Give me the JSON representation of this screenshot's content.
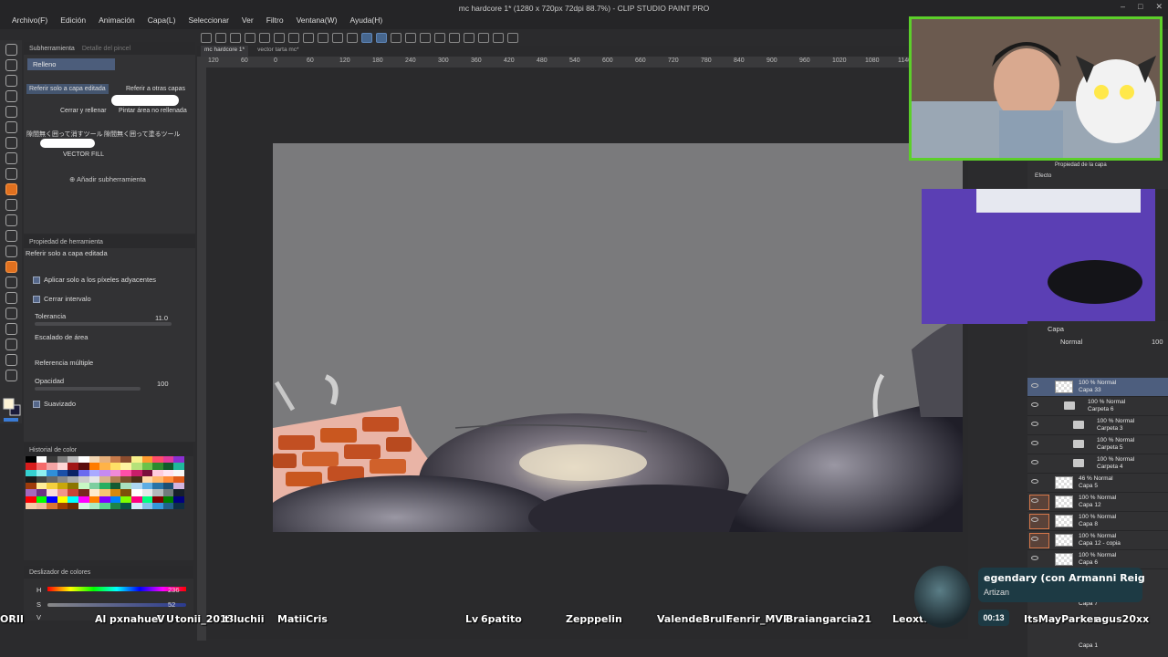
{
  "window": {
    "title": "mc hardcore 1* (1280 x 720px 72dpi 88.7%) - CLIP STUDIO PAINT PRO",
    "controls": [
      "–",
      "□",
      "✕"
    ]
  },
  "menu": [
    "Archivo(F)",
    "Edición",
    "Animación",
    "Capa(L)",
    "Seleccionar",
    "Ver",
    "Filtro",
    "Ventana(W)",
    "Ayuda(H)"
  ],
  "doc_tabs": [
    "mc hardcore 1*",
    "vector tarta mc*"
  ],
  "ruler_ticks": [
    "120",
    "60",
    "0",
    "60",
    "120",
    "180",
    "240",
    "300",
    "360",
    "420",
    "480",
    "540",
    "600",
    "660",
    "720",
    "780",
    "840",
    "900",
    "960",
    "1020",
    "1080",
    "1140"
  ],
  "subtool": {
    "tab": "Subherramienta",
    "tab2": "Detalle del pincel",
    "group": "Relleno",
    "items": [
      "Referir solo a capa editada",
      "Referir a otras capas",
      "Cerrar y rellenar",
      "Pintar área no rellenada",
      "隙間無く囲って消すツール",
      "隙間無く囲って塗るツール",
      "VECTOR FILL"
    ],
    "add": "Añadir subherramienta"
  },
  "tool_property": {
    "tab": "Propiedad de herramienta",
    "name": "Referir solo a capa editada",
    "adjacent": "Aplicar solo a los píxeles adyacentes",
    "close_gap": "Cerrar intervalo",
    "tolerance_label": "Tolerancia",
    "tolerance_value": "11.0",
    "scale_label": "Escalado de área",
    "multi_ref": "Referencia múltiple",
    "opacity_label": "Opacidad",
    "opacity_value": "100",
    "smooth": "Suavizado"
  },
  "color_panel": {
    "tab": "Historial de color",
    "slider_tab": "Deslizador de colores",
    "h_label": "H",
    "h_value": "236",
    "s_label": "S",
    "s_value": "52",
    "v_label": "V",
    "swatches": [
      "#000000",
      "#ffffff",
      "#3a3a3a",
      "#7a7a7a",
      "#bbbbbb",
      "#ffffff",
      "#f2d6b3",
      "#e7b07b",
      "#c87b4b",
      "#8b4c2e",
      "#f7f08a",
      "#ff9a2f",
      "#ff4d6a",
      "#e13a9a",
      "#8b2fd1",
      "#d81c1c",
      "#f56a6a",
      "#f4a4a4",
      "#ffd6d6",
      "#a01616",
      "#5a0c0c",
      "#ff7b00",
      "#ffb347",
      "#ffe066",
      "#fff3a0",
      "#b5e27a",
      "#6cc24a",
      "#2d8a2d",
      "#0e5a2a",
      "#1fb89c",
      "#35d1d1",
      "#8ff0f0",
      "#2f8fd9",
      "#1a4fa8",
      "#0b2266",
      "#6a6af0",
      "#a9a9ff",
      "#c58af2",
      "#f08ad8",
      "#ff4fa8",
      "#c91e6a",
      "#7a0f3c",
      "#ffccdd",
      "#ffe4f0",
      "#f7f7f7",
      "#1b1b1b",
      "#444444",
      "#666666",
      "#888888",
      "#aaaaaa",
      "#cccccc",
      "#e6e6e6",
      "#d9b38c",
      "#b07d4f",
      "#7a4e2c",
      "#4e2f18",
      "#ffd9a8",
      "#ffb86b",
      "#ff8c3a",
      "#e05a1a",
      "#9e3b0a",
      "#ffee99",
      "#f4d03f",
      "#c9a70a",
      "#8b7500",
      "#c8f7c5",
      "#7dcea0",
      "#27ae60",
      "#145a32",
      "#a9dfbf",
      "#aed6f1",
      "#5dade2",
      "#2874a6",
      "#1b4f72",
      "#d2b4de",
      "#a569bd",
      "#6c3483",
      "#fadbd8",
      "#f1948a",
      "#cb4335",
      "#78281f",
      "#fdebd0",
      "#f8c471",
      "#d68910",
      "#7e5109",
      "#ffffff",
      "#e5e8e8",
      "#b2babb",
      "#707b7c",
      "#17202a",
      "#ff0000",
      "#00ff00",
      "#0000ff",
      "#ffff00",
      "#00ffff",
      "#ff00ff",
      "#ff8000",
      "#8000ff",
      "#0080ff",
      "#80ff00",
      "#ff0080",
      "#00ff80",
      "#800000",
      "#008000",
      "#000080",
      "#f5cba7",
      "#edbb99",
      "#dc7633",
      "#a04000",
      "#6e2c00",
      "#d5f5e3",
      "#abebc6",
      "#58d68d",
      "#1e8449",
      "#0b5345",
      "#d6eaf8",
      "#85c1e9",
      "#3498db",
      "#21618c",
      "#0e2f44"
    ]
  },
  "layer_panel": {
    "tab": "Capa",
    "blend": "Normal",
    "opacity": "100",
    "prop_tab": "Propiedad de la capa",
    "effect": "Efecto",
    "layers": [
      {
        "pct": "100 % Normal",
        "name": "Capa 33",
        "kind": "layer",
        "selected": true
      },
      {
        "pct": "100 % Normal",
        "name": "Carpeta 6",
        "kind": "folder"
      },
      {
        "pct": "100 % Normal",
        "name": "Carpeta 3",
        "kind": "folder"
      },
      {
        "pct": "100 % Normal",
        "name": "Carpeta 5",
        "kind": "folder"
      },
      {
        "pct": "100 % Normal",
        "name": "Carpeta 4",
        "kind": "folder"
      },
      {
        "pct": "46 % Normal",
        "name": "Capa 5",
        "kind": "layer"
      },
      {
        "pct": "100 % Normal",
        "name": "Capa 12",
        "kind": "layer",
        "marked": true
      },
      {
        "pct": "100 % Normal",
        "name": "Capa 8",
        "kind": "layer",
        "marked": true
      },
      {
        "pct": "100 % Normal",
        "name": "Capa 12 - copia",
        "kind": "layer",
        "marked": true
      },
      {
        "pct": "100 % Normal",
        "name": "Capa 6",
        "kind": "layer"
      }
    ],
    "bottom": [
      "Capa 7",
      "Capa 1"
    ]
  },
  "overlay": {
    "viewers": [
      "ORII",
      "Al",
      "pxnahuel",
      "V",
      "U",
      "tonii_2013",
      "t",
      "luchii",
      "MatiiCris",
      "Lv",
      "6patito",
      "Zepppelin",
      "ValendeBrulli",
      "Fenrir_MVP",
      "Braiangarcia21",
      "Leoxtrew",
      "ItsMayParker",
      "agus20xx"
    ],
    "alert_title": "egendary (con Armanni Reig",
    "alert_sub": "Artizan",
    "alert_timer": "00:13"
  },
  "colors": {
    "accent": "#4d5e7e",
    "active_tool": "#e0701f",
    "webcam_border": "#5ccf2a",
    "canvas_gray": "#7a7a7c",
    "brick": "#c24f22"
  }
}
